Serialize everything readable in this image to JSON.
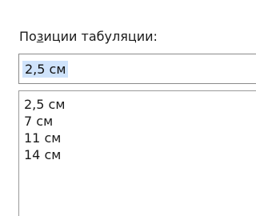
{
  "tab_stop": {
    "label_prefix": "По",
    "label_accel": "з",
    "label_rest": "иции табуляции:",
    "input_value": "2,5 см",
    "list_items": [
      "2,5 см",
      "7 см",
      "11 см",
      "14 см"
    ]
  },
  "colors": {
    "selection_highlight": "#cfe3fb",
    "border": "#8a8a8a"
  }
}
